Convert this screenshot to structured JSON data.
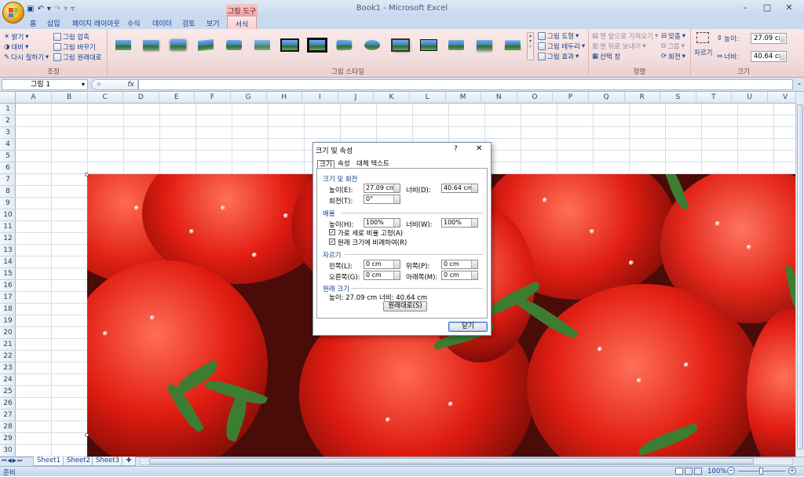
{
  "window": {
    "title": "Book1 - Microsoft Excel",
    "context_group": "그림 도구",
    "minimize": "–",
    "maximize": "□",
    "close": "✕"
  },
  "tabs": [
    "홈",
    "삽입",
    "페이지 레이아웃",
    "수식",
    "데이터",
    "검토",
    "보기",
    "서식"
  ],
  "active_tab": "서식",
  "ribbon": {
    "adjust": {
      "label": "조정",
      "brightness": "밝기",
      "contrast": "대비",
      "recolor": "다시 칠하기",
      "compress": "그림 압축",
      "change": "그림 바꾸기",
      "reset": "그림 원래대로"
    },
    "styles": {
      "label": "그림 스타일",
      "shape": "그림 도형",
      "border": "그림 테두리",
      "effects": "그림 효과"
    },
    "arrange": {
      "label": "정렬",
      "bring_front": "맨 앞으로 가져오기",
      "send_back": "맨 뒤로 보내기",
      "selection_pane": "선택 창",
      "align": "맞춤",
      "group": "그룹",
      "rotate": "회전"
    },
    "size": {
      "label": "크기",
      "crop": "자르기",
      "height_label": "높이:",
      "height_value": "27.09 cm",
      "width_label": "너비:",
      "width_value": "40.64 cm"
    }
  },
  "formula_bar": {
    "name_box": "그림 1",
    "fx": "fx",
    "formula": ""
  },
  "columns": [
    "A",
    "B",
    "C",
    "D",
    "E",
    "F",
    "G",
    "H",
    "I",
    "J",
    "K",
    "L",
    "M",
    "N",
    "O",
    "P",
    "Q",
    "R",
    "S",
    "T",
    "U",
    "V"
  ],
  "rows": [
    "1",
    "2",
    "3",
    "4",
    "5",
    "6",
    "7",
    "8",
    "9",
    "10",
    "11",
    "12",
    "13",
    "14",
    "15",
    "16",
    "17",
    "18",
    "19",
    "20",
    "21",
    "22",
    "23",
    "24",
    "25",
    "26",
    "27",
    "28",
    "29",
    "30"
  ],
  "sheets": [
    "Sheet1",
    "Sheet2",
    "Sheet3"
  ],
  "status": {
    "ready": "준비",
    "zoom": "100%"
  },
  "dialog": {
    "title": "크기 및 속성",
    "help": "?",
    "close": "✕",
    "tabs": [
      "크기",
      "속성",
      "대체 텍스트"
    ],
    "size_rotate": {
      "heading": "크기 및 회전",
      "height_label": "높이(E):",
      "height_value": "27.09 cm",
      "width_label": "너비(D):",
      "width_value": "40.64 cm",
      "rotation_label": "회전(T):",
      "rotation_value": "0°"
    },
    "scale": {
      "heading": "배율",
      "height_label": "높이(H):",
      "height_value": "100%",
      "width_label": "너비(W):",
      "width_value": "100%",
      "lock_aspect": "가로 세로 비율 고정(A)",
      "relative_original": "원래 크기에 비례하여(R)"
    },
    "crop": {
      "heading": "자르기",
      "left_label": "왼쪽(L):",
      "left_value": "0 cm",
      "top_label": "위쪽(P):",
      "top_value": "0 cm",
      "right_label": "오른쪽(G):",
      "right_value": "0 cm",
      "bottom_label": "아래쪽(M):",
      "bottom_value": "0 cm"
    },
    "original": {
      "heading": "원래 크기",
      "height_text": "높이:  27.09 cm",
      "width_text": "너비:  40.64 cm",
      "reset_button": "원래대로(S)"
    },
    "close_button": "닫기"
  }
}
